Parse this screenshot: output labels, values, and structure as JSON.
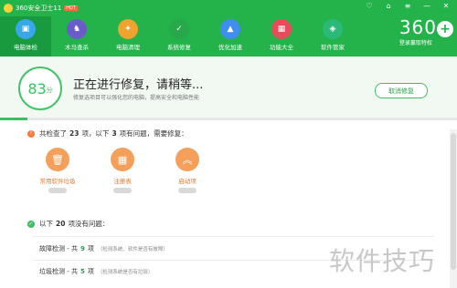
{
  "window": {
    "title": "360安全卫士11",
    "hot_badge": "HOT"
  },
  "window_controls": [
    "♡",
    "⌂",
    "≡",
    "—",
    "✕"
  ],
  "nav": [
    {
      "label": "电脑体检",
      "icon": "monitor-check-icon",
      "active": true,
      "color": "#3aa7e8"
    },
    {
      "label": "木马查杀",
      "icon": "horse-shield-icon",
      "active": false,
      "color": "#6b5ac9"
    },
    {
      "label": "电脑清理",
      "icon": "broom-icon",
      "active": false,
      "color": "#f1a32f"
    },
    {
      "label": "系统修复",
      "icon": "shield-icon",
      "active": false,
      "color": "#27a84a"
    },
    {
      "label": "优化加速",
      "icon": "rocket-icon",
      "active": false,
      "color": "#3f8ef0"
    },
    {
      "label": "功能大全",
      "icon": "grid-icon",
      "active": false,
      "color": "#e94b5a"
    },
    {
      "label": "软件管家",
      "icon": "app-store-icon",
      "active": false,
      "color": "#2bb97a"
    }
  ],
  "brand": {
    "number": "360",
    "subtitle": "登录赢取特权",
    "plus": "+"
  },
  "status": {
    "score": "83",
    "score_unit": "分",
    "headline": "正在进行修复，请稍等...",
    "subline": "修复选项目可以强化您的电脑，提高安全和电脑性能",
    "cancel_label": "取消修复",
    "progress_percent": 6
  },
  "summary": {
    "prefix": "共检查了",
    "checked_count": "23",
    "middle": "项，以下",
    "problem_count": "3",
    "suffix": "项有问题，需要修复："
  },
  "problems": [
    {
      "label": "常用软件垃圾",
      "icon": "trash-icon"
    },
    {
      "label": "注册表",
      "icon": "grid-icon"
    },
    {
      "label": "启动项",
      "icon": "chevrons-up-icon"
    }
  ],
  "ok_summary": {
    "prefix": "以下",
    "count": "20",
    "suffix": "项没有问题："
  },
  "ok_rows": [
    {
      "name": "故障检测 - 共",
      "count": "9",
      "unit": "项",
      "desc": "（检测系统、软件是否有故障）"
    },
    {
      "name": "垃圾检测 - 共",
      "count": "5",
      "unit": "项",
      "desc": "（检测系统是否有垃圾）"
    }
  ],
  "watermark": "软件技巧",
  "colors": {
    "accent": "#24b24b",
    "warning": "#ff7a3a",
    "problem_icon": "#f5a05a"
  }
}
